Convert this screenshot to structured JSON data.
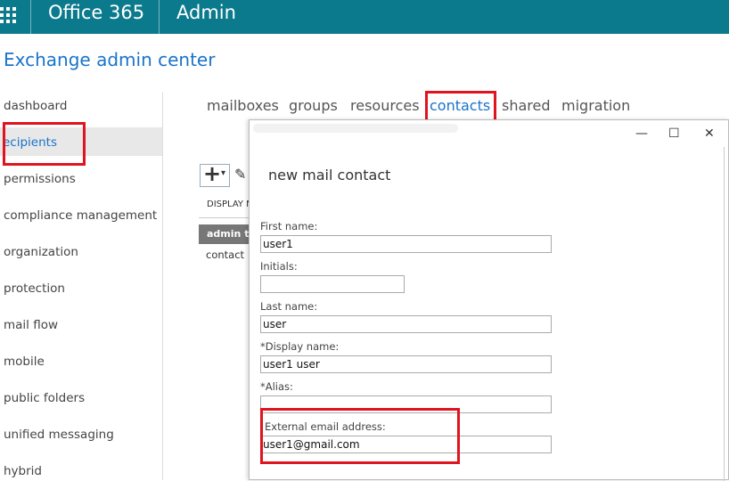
{
  "topbar": {
    "suite": "Office 365",
    "section": "Admin"
  },
  "page_title": "Exchange admin center",
  "nav": {
    "items": [
      {
        "label": "dashboard"
      },
      {
        "label": "ecipients"
      },
      {
        "label": "permissions"
      },
      {
        "label": "compliance management"
      },
      {
        "label": "organization"
      },
      {
        "label": "protection"
      },
      {
        "label": "mail flow"
      },
      {
        "label": "mobile"
      },
      {
        "label": "public folders"
      },
      {
        "label": "unified messaging"
      },
      {
        "label": "hybrid"
      }
    ],
    "selected": "ecipients"
  },
  "tabs": [
    {
      "label": "mailboxes"
    },
    {
      "label": "groups"
    },
    {
      "label": "resources"
    },
    {
      "label": "contacts"
    },
    {
      "label": "shared"
    },
    {
      "label": "migration"
    }
  ],
  "active_tab": "contacts",
  "toolbar": {
    "add_glyph": "+",
    "dropdown_glyph": "▾",
    "edit_glyph": "✎"
  },
  "list": {
    "header": "DISPLAY N",
    "rows": [
      {
        "text": "admin t"
      },
      {
        "text": "contact"
      }
    ]
  },
  "dialog": {
    "heading": "new mail contact",
    "window_buttons": {
      "minimize": "—",
      "maximize": "☐",
      "close": "✕"
    },
    "fields": {
      "first_name": {
        "label": "First name:",
        "value": "user1"
      },
      "initials": {
        "label": "Initials:",
        "value": ""
      },
      "last_name": {
        "label": "Last name:",
        "value": "user"
      },
      "display_name": {
        "label": "*Display name:",
        "value": "user1 user"
      },
      "alias": {
        "label": "*Alias:",
        "value": ""
      },
      "external_email": {
        "label": "External email address:",
        "value": "user1@gmail.com"
      }
    }
  },
  "colors": {
    "topbar": "#0b7a8c",
    "accent": "#1a73c9",
    "highlight": "#e0141e"
  }
}
